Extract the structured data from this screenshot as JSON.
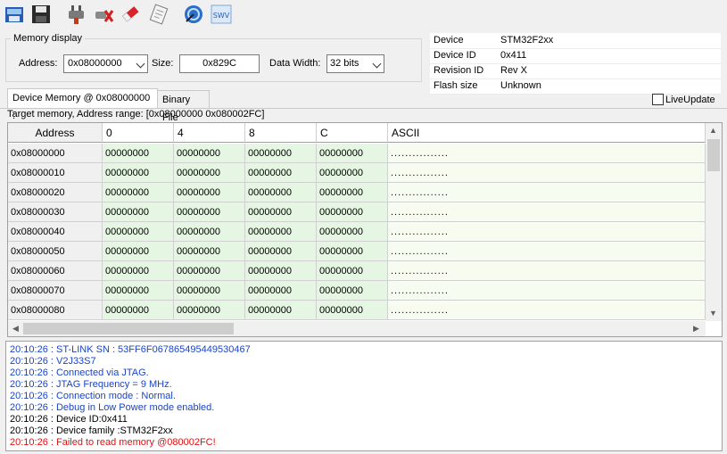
{
  "colors": {
    "log_info": "#1a44c8",
    "log_default": "#000000",
    "log_error": "#e01010",
    "data_cell_bg": "#e5f7e3",
    "ascii_cell_bg": "#f6fcef"
  },
  "toolbar": {
    "icons": [
      "open-file-icon",
      "save-icon",
      "connect-icon",
      "disconnect-icon",
      "erase-icon",
      "program-verify-icon",
      "core-reset-icon",
      "swv-icon"
    ],
    "swv_label": "SWV"
  },
  "memory_display": {
    "title": "Memory display",
    "address_label": "Address:",
    "address_value": "0x08000000",
    "size_label": "Size:",
    "size_value": "0x829C",
    "width_label": "Data Width:",
    "width_value": "32 bits"
  },
  "device_info": [
    {
      "label": "Device",
      "value": "STM32F2xx"
    },
    {
      "label": "Device ID",
      "value": "0x411"
    },
    {
      "label": "Revision ID",
      "value": "Rev X"
    },
    {
      "label": "Flash size",
      "value": "Unknown"
    }
  ],
  "tabs": [
    {
      "label": "Device Memory @ 0x08000000 :"
    },
    {
      "label": "Binary File"
    }
  ],
  "live_update_label": "LiveUpdate",
  "range_text": "Target memory, Address range: [0x08000000 0x080002FC]",
  "grid": {
    "columns": [
      "Address",
      "0",
      "4",
      "8",
      "C",
      "ASCII"
    ],
    "rows": [
      {
        "address": "0x08000000",
        "w0": "00000000",
        "w4": "00000000",
        "w8": "00000000",
        "wc": "00000000",
        "ascii": "................"
      },
      {
        "address": "0x08000010",
        "w0": "00000000",
        "w4": "00000000",
        "w8": "00000000",
        "wc": "00000000",
        "ascii": "................"
      },
      {
        "address": "0x08000020",
        "w0": "00000000",
        "w4": "00000000",
        "w8": "00000000",
        "wc": "00000000",
        "ascii": "................"
      },
      {
        "address": "0x08000030",
        "w0": "00000000",
        "w4": "00000000",
        "w8": "00000000",
        "wc": "00000000",
        "ascii": "................"
      },
      {
        "address": "0x08000040",
        "w0": "00000000",
        "w4": "00000000",
        "w8": "00000000",
        "wc": "00000000",
        "ascii": "................"
      },
      {
        "address": "0x08000050",
        "w0": "00000000",
        "w4": "00000000",
        "w8": "00000000",
        "wc": "00000000",
        "ascii": "................"
      },
      {
        "address": "0x08000060",
        "w0": "00000000",
        "w4": "00000000",
        "w8": "00000000",
        "wc": "00000000",
        "ascii": "................"
      },
      {
        "address": "0x08000070",
        "w0": "00000000",
        "w4": "00000000",
        "w8": "00000000",
        "wc": "00000000",
        "ascii": "................"
      },
      {
        "address": "0x08000080",
        "w0": "00000000",
        "w4": "00000000",
        "w8": "00000000",
        "wc": "00000000",
        "ascii": "................"
      }
    ]
  },
  "log": [
    {
      "text": "20:10:26 : ST-LINK SN : 53FF6F067865495449530467",
      "level": "info"
    },
    {
      "text": "20:10:26 : V2J33S7",
      "level": "info"
    },
    {
      "text": "20:10:26 : Connected via JTAG.",
      "level": "info"
    },
    {
      "text": "20:10:26 : JTAG Frequency = 9 MHz.",
      "level": "info"
    },
    {
      "text": "20:10:26 : Connection mode : Normal.",
      "level": "info"
    },
    {
      "text": "20:10:26 : Debug in Low Power mode enabled.",
      "level": "info"
    },
    {
      "text": "20:10:26 : Device ID:0x411",
      "level": "default"
    },
    {
      "text": "20:10:26 : Device family :STM32F2xx",
      "level": "default"
    },
    {
      "text": "20:10:26 : Failed to read memory @080002FC!",
      "level": "error"
    }
  ]
}
